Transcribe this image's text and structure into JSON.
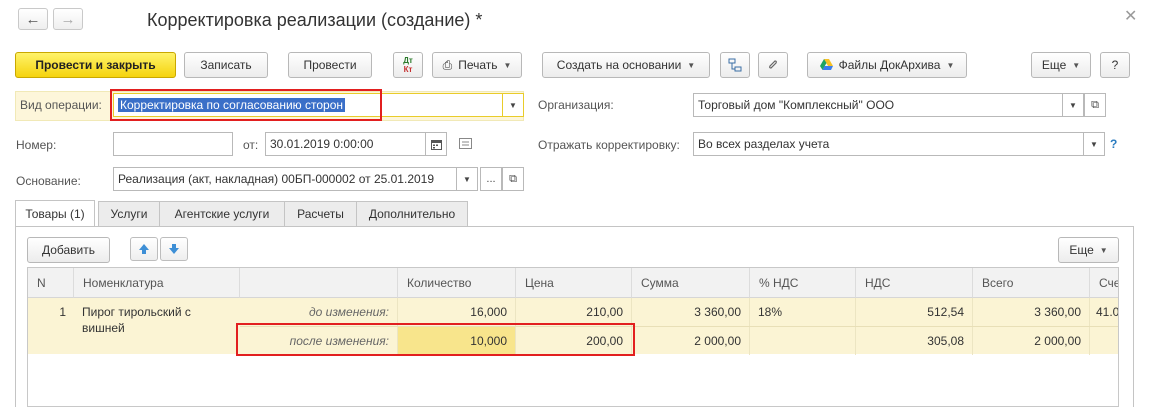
{
  "window": {
    "title": "Корректировка реализации (создание) *"
  },
  "toolbar": {
    "post_close": "Провести и закрыть",
    "save": "Записать",
    "post": "Провести",
    "dtkt_top": "Дт",
    "dtkt_bottom": "Кт",
    "print": "Печать",
    "create_based": "Создать на основании",
    "files": "Файлы ДокАрхива",
    "more": "Еще",
    "help": "?"
  },
  "form": {
    "operation_label": "Вид операции:",
    "operation_value": "Корректировка по согласованию сторон",
    "org_label": "Организация:",
    "org_value": "Торговый дом \"Комплексный\" ООО",
    "number_label": "Номер:",
    "number_value": "",
    "from_label": "от:",
    "date_value": "30.01.2019  0:00:00",
    "reflect_label": "Отражать корректировку:",
    "reflect_value": "Во всех разделах учета",
    "reflect_help": "?",
    "basis_label": "Основание:",
    "basis_value": "Реализация (акт, накладная) 00БП-000002 от 25.01.2019",
    "basis_more": "..."
  },
  "tabs": [
    {
      "label": "Товары (1)"
    },
    {
      "label": "Услуги"
    },
    {
      "label": "Агентские услуги"
    },
    {
      "label": "Расчеты"
    },
    {
      "label": "Дополнительно"
    }
  ],
  "table_toolbar": {
    "add": "Добавить",
    "more": "Еще"
  },
  "table": {
    "headers": [
      "N",
      "Номенклатура",
      "",
      "Количество",
      "Цена",
      "Сумма",
      "% НДС",
      "НДС",
      "Всего",
      "Сче"
    ],
    "row": {
      "n": "1",
      "item": "Пирог тирольский с вишней",
      "before": {
        "label": "до изменения:",
        "qty": "16,000",
        "price": "210,00",
        "sum": "3 360,00",
        "vat_rate": "18%",
        "vat": "512,54",
        "total": "3 360,00",
        "acct": "41.0"
      },
      "after": {
        "label": "после изменения:",
        "qty": "10,000",
        "price": "200,00",
        "sum": "2 000,00",
        "vat": "305,08",
        "total": "2 000,00"
      }
    }
  },
  "colors": {
    "highlight": "#e21f1f",
    "primary_button": "#f5d30e",
    "row_background": "#fbf4d4",
    "selection": "#3a6fc8"
  }
}
